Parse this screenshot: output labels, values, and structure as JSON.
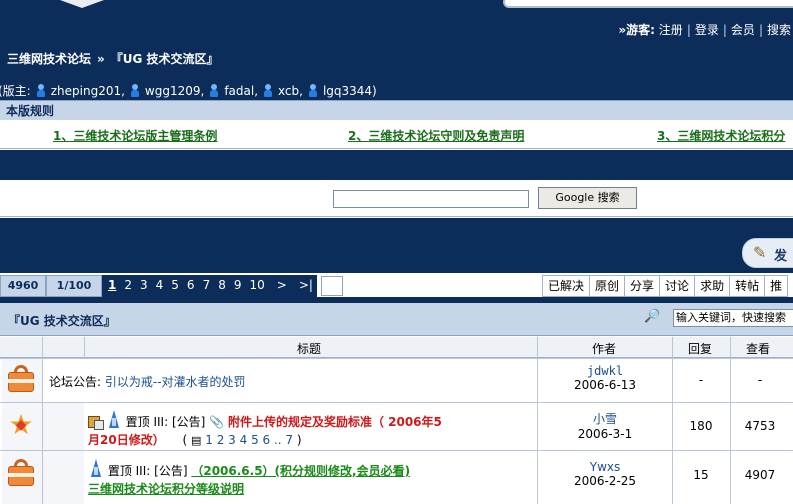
{
  "header": {
    "guest_label": "»游客:",
    "links": [
      "注册",
      "登录",
      "会员",
      "搜索"
    ],
    "breadcrumb": {
      "home": "三维网技术论坛",
      "separator": "»",
      "current": "『UG 技术交流区』"
    },
    "moderators_prefix": "(版主:",
    "moderators": [
      "zheping201,",
      "wgg1209,",
      "fadal,",
      "xcb,",
      "lgq3344)"
    ]
  },
  "rules": {
    "title": "本版规则",
    "items": [
      "1、三维技术论坛版主管理条例",
      "2、三维技术论坛守则及免责声明",
      "3、三维网技术论坛积分"
    ]
  },
  "google_search": {
    "button": "Google 搜索",
    "value": ""
  },
  "post_button": {
    "label": "发"
  },
  "pager": {
    "total": "4960",
    "page_info": "1/100",
    "pages": [
      "1",
      "2",
      "3",
      "4",
      "5",
      "6",
      "7",
      "8",
      "9",
      "10"
    ],
    "next": ">",
    "last": ">|",
    "current": "1"
  },
  "filters": [
    "已解决",
    "原创",
    "分享",
    "讨论",
    "求助",
    "转帖",
    "推"
  ],
  "forum": {
    "title": "『UG 技术交流区』",
    "keyword_placeholder": "输入关键词，快速搜索"
  },
  "columns": {
    "title": "标题",
    "author": "作者",
    "replies": "回复",
    "views": "查看"
  },
  "rows": [
    {
      "prefix": "论坛公告:",
      "title": "引以为戒--对灌水者的处罚",
      "author": "jdwkl",
      "date": "2006-6-13",
      "replies": "-",
      "views": "-"
    },
    {
      "pin": "置顶 III:",
      "tag": "[公告]",
      "attach": "📎",
      "title_line1": "附件上传的规定及奖励标准（ 2006年5",
      "title_line2": "月20日修改）",
      "pages_open": "(",
      "pages": "1 2 3 4 5 6 .. 7",
      "pages_close": ")",
      "author": "小雪",
      "date": "2006-3-1",
      "replies": "180",
      "views": "4753"
    },
    {
      "pin": "置顶 III:",
      "tag": "[公告]",
      "title_line1": "（2006.6.5）(积分规则修改,会员必看)",
      "title_line2": "三维网技术论坛积分等级说明",
      "author": "Ywxs",
      "date": "2006-2-25",
      "replies": "15",
      "views": "4907"
    }
  ],
  "colors": {
    "header_bg": "#0c2c5a",
    "bar_bg": "#c7d5e8",
    "rule_link": "#1a6e1a",
    "red_title": "#d01818",
    "green_title": "#1a8a1a"
  }
}
